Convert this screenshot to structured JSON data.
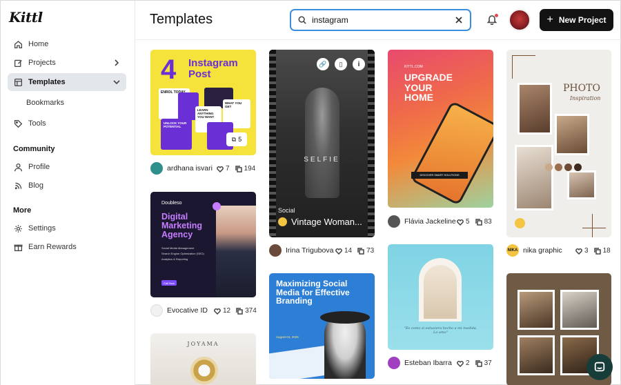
{
  "app": {
    "logo": "Kittl"
  },
  "sidebar": {
    "items": [
      {
        "label": "Home",
        "icon": "home-icon"
      },
      {
        "label": "Projects",
        "icon": "edit-icon"
      },
      {
        "label": "Templates",
        "icon": "template-icon"
      },
      {
        "label": "Bookmarks"
      },
      {
        "label": "Tools",
        "icon": "tag-icon"
      }
    ],
    "community_title": "Community",
    "community": [
      {
        "label": "Profile",
        "icon": "user-icon"
      },
      {
        "label": "Blog",
        "icon": "rss-icon"
      }
    ],
    "more_title": "More",
    "more": [
      {
        "label": "Settings",
        "icon": "gear-icon"
      },
      {
        "label": "Earn Rewards",
        "icon": "gift-icon"
      }
    ]
  },
  "header": {
    "title": "Templates",
    "search_value": "instagram",
    "new_project_label": "New Project"
  },
  "cards": [
    {
      "title_big": "4",
      "title": "Instagram Post",
      "lines": [
        "ENROL TODAY",
        "LEARN ANYTHING YOU WANT",
        "WHAT YOU GET",
        "UNLOCK YOUR POTENTIAL"
      ],
      "pages": "5",
      "author": "ardhana isvari",
      "likes": "7",
      "uses": "194"
    },
    {
      "word": "SELFIE",
      "badge": "Social",
      "title": "Vintage Woman...",
      "author": "Irina Trigubova",
      "likes": "14",
      "uses": "73"
    },
    {
      "brand": "KITTL.COM",
      "title": "UPGRADE YOUR HOME",
      "cta": "DISCOVER SMART SOLUTIONS",
      "author": "Flávia Jackeline",
      "likes": "5",
      "uses": "83"
    },
    {
      "title": "PHOTO",
      "subtitle": "Inspiration",
      "author": "nika graphic",
      "author_initials": "NIKA",
      "likes": "3",
      "uses": "18"
    },
    {
      "brand": "Doubleso",
      "title": "Digital Marketing Agency",
      "lines": [
        "Social Media Management",
        "Search Engine Optimization (SEO)",
        "Analytics & Reporting"
      ],
      "btn": "Call Now",
      "author": "Evocative ID",
      "likes": "12",
      "uses": "374"
    },
    {
      "title": "Maximizing Social Media for Effective Branding",
      "date": "August 04, 2025",
      "author": "Esteban Ibarra",
      "likes": "2",
      "uses": "37"
    },
    {
      "quote": "\"Es como si estuviera hecho a mi medida. Lo amo\"",
      "author": "",
      "likes": "",
      "uses": ""
    },
    {
      "title": "JOYAMA"
    },
    {
      "title": ""
    }
  ],
  "colors": {
    "accent": "#3a8dde",
    "button": "#131313"
  }
}
